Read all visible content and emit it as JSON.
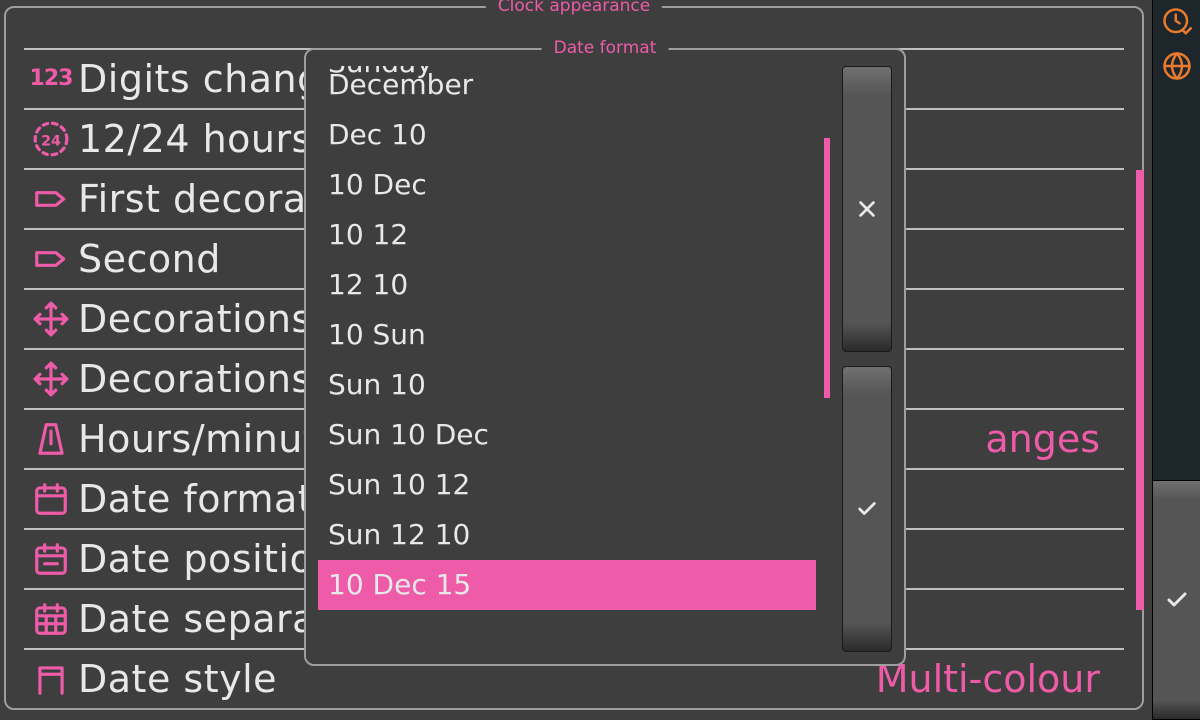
{
  "colors": {
    "accent": "#ee5ba8",
    "orange": "#e97a2e",
    "bg": "#3e3e3e"
  },
  "side_rail": {
    "items": [
      {
        "icon": "clock-check-icon"
      },
      {
        "icon": "globe-icon"
      }
    ]
  },
  "main": {
    "title": "Clock appearance",
    "rows": [
      {
        "icon": "digits-icon",
        "label": "Digits change effect",
        "value": ""
      },
      {
        "icon": "h24-icon",
        "label": "12/24 hours",
        "value": ""
      },
      {
        "icon": "tag-icon",
        "label": "First decoration",
        "value": ""
      },
      {
        "icon": "tag-icon",
        "label": "Second",
        "value": ""
      },
      {
        "icon": "move-icon",
        "label": "Decorations placement",
        "value": ""
      },
      {
        "icon": "move-icon",
        "label": "Decorations placement",
        "value": ""
      },
      {
        "icon": "metronome-icon",
        "label": "Hours/minutes separator",
        "value": "anges"
      },
      {
        "icon": "calendar-icon",
        "label": "Date format",
        "value": ""
      },
      {
        "icon": "calendar-dash-icon",
        "label": "Date position",
        "value": ""
      },
      {
        "icon": "calendar-grid-icon",
        "label": "Date separator",
        "value": ""
      },
      {
        "icon": "calendar-open-icon",
        "label": "Date style",
        "value": "Multi-colour"
      }
    ]
  },
  "popup": {
    "title": "Date format",
    "options": [
      {
        "label": "Sunday",
        "selected": false,
        "cut_top": true
      },
      {
        "label": "December",
        "selected": false
      },
      {
        "label": "Dec 10",
        "selected": false
      },
      {
        "label": "10 Dec",
        "selected": false
      },
      {
        "label": "10 12",
        "selected": false
      },
      {
        "label": "12 10",
        "selected": false
      },
      {
        "label": "10 Sun",
        "selected": false
      },
      {
        "label": "Sun 10",
        "selected": false
      },
      {
        "label": "Sun 10 Dec",
        "selected": false
      },
      {
        "label": "Sun 10 12",
        "selected": false
      },
      {
        "label": "Sun 12 10",
        "selected": false
      },
      {
        "label": "10 Dec 15",
        "selected": true
      }
    ],
    "buttons": {
      "cancel_icon": "close-icon",
      "confirm_icon": "check-icon"
    }
  }
}
